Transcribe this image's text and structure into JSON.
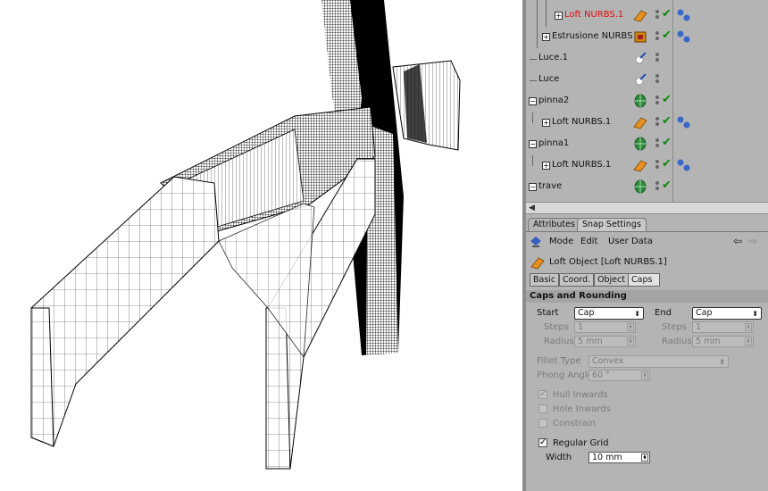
{
  "object_manager": {
    "rows": [
      {
        "name": "Loft NURBS.1",
        "selected": true
      },
      {
        "name": "Estrusione NURBS",
        "selected": false
      },
      {
        "name": "Luce.1",
        "selected": false
      },
      {
        "name": "Luce",
        "selected": false
      },
      {
        "name": "pinna2",
        "selected": false
      },
      {
        "name": "Loft NURBS.1",
        "selected": false
      },
      {
        "name": "pinna1",
        "selected": false
      },
      {
        "name": "Loft NURBS.1",
        "selected": false
      },
      {
        "name": "trave",
        "selected": false
      }
    ]
  },
  "attributes": {
    "tabs": [
      "Attributes",
      "Snap Settings"
    ],
    "menu": [
      "Mode",
      "Edit",
      "User Data"
    ],
    "object_title": "Loft Object [Loft NURBS.1]",
    "subtabs": [
      "Basic",
      "Coord.",
      "Object",
      "Caps"
    ],
    "section_title": "Caps and Rounding",
    "start": {
      "label": "Start",
      "value": "Cap",
      "steps_label": "Steps",
      "steps": "1",
      "radius_label": "Radius",
      "radius": "5 mm"
    },
    "end": {
      "label": "End",
      "value": "Cap",
      "steps_label": "Steps",
      "steps": "1",
      "radius_label": "Radius",
      "radius": "5 mm"
    },
    "fillet_type": {
      "label": "Fillet Type",
      "value": "Convex"
    },
    "phong_angle": {
      "label": "Phong Angle",
      "value": "60 °"
    },
    "hull_inwards": {
      "label": "Hull Inwards",
      "checked": true
    },
    "hole_inwards": {
      "label": "Hole Inwards",
      "checked": false
    },
    "constrain": {
      "label": "Constrain",
      "checked": false
    },
    "regular_grid": {
      "label": "Regular Grid",
      "checked": true
    },
    "width": {
      "label": "Width",
      "value": "10 mm"
    }
  },
  "colors": {
    "selected_text": "#e01010",
    "panel_bg": "#b4b4b4",
    "check_green": "#118811"
  }
}
